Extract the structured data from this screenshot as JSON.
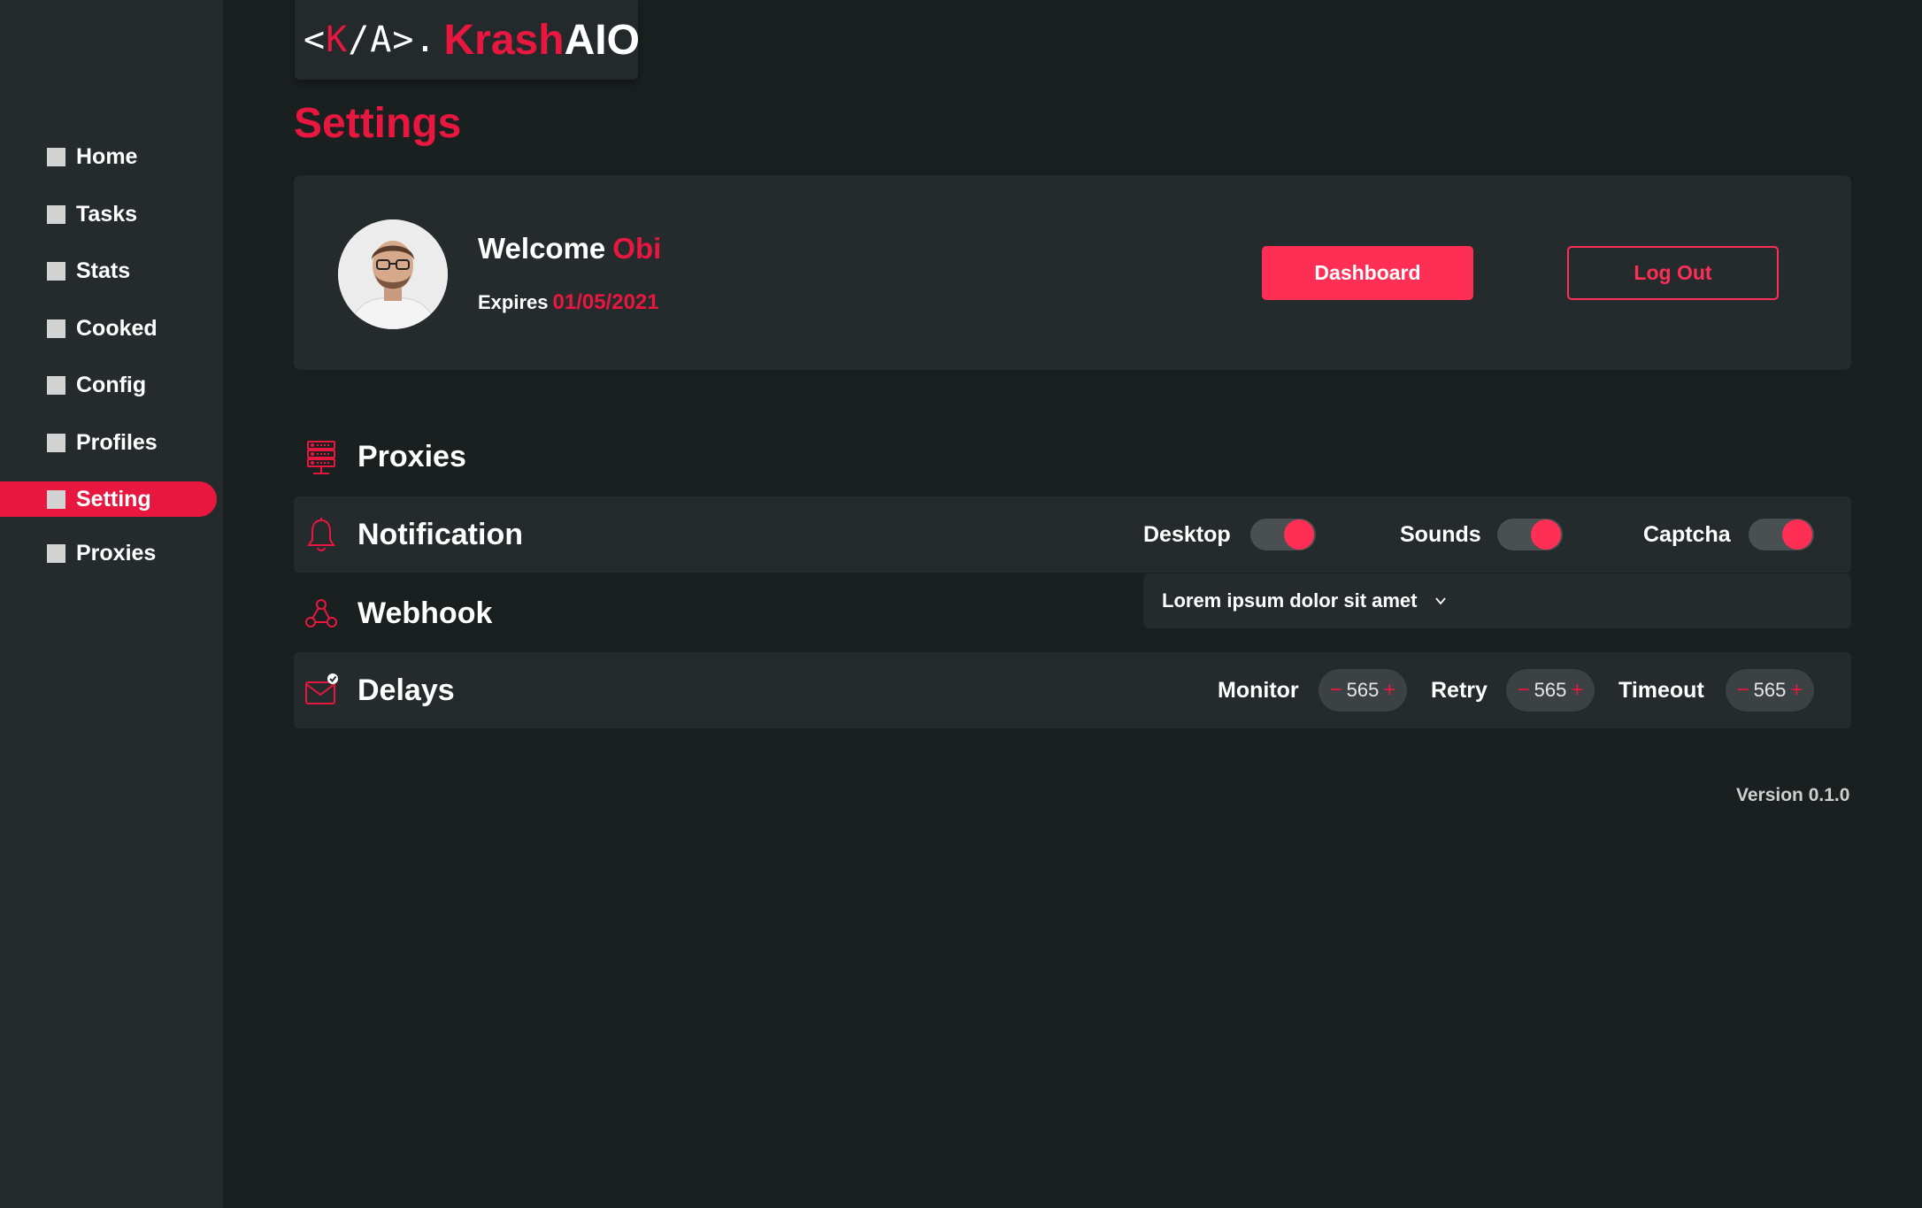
{
  "logo": {
    "mark_left": "<",
    "mark_k": "K",
    "mark_rest": "/A>.",
    "name_red": "Krash",
    "name_white": "AIO"
  },
  "page_title": "Settings",
  "sidebar": {
    "items": [
      {
        "label": "Home",
        "active": false
      },
      {
        "label": "Tasks",
        "active": false
      },
      {
        "label": "Stats",
        "active": false
      },
      {
        "label": "Cooked",
        "active": false
      },
      {
        "label": "Config",
        "active": false
      },
      {
        "label": "Profiles",
        "active": false
      },
      {
        "label": "Setting",
        "active": true
      },
      {
        "label": "Proxies",
        "active": false
      }
    ]
  },
  "profile": {
    "welcome_label": "Welcome",
    "username": "Obi",
    "expires_label": "Expires",
    "expires_date": "01/05/2021",
    "dashboard_button": "Dashboard",
    "logout_button": "Log Out"
  },
  "sections": {
    "proxies": {
      "title": "Proxies",
      "icon": "server-icon"
    },
    "notification": {
      "title": "Notification",
      "icon": "bell-icon",
      "toggles": [
        {
          "label": "Desktop",
          "on": true
        },
        {
          "label": "Sounds",
          "on": true
        },
        {
          "label": "Captcha",
          "on": true
        }
      ]
    },
    "webhook": {
      "title": "Webhook",
      "icon": "webhook-icon",
      "selected": "Lorem ipsum dolor sit amet"
    },
    "delays": {
      "title": "Delays",
      "icon": "mail-check-icon",
      "steppers": [
        {
          "label": "Monitor",
          "value": "565",
          "minus": "−",
          "plus": "+"
        },
        {
          "label": "Retry",
          "value": "565",
          "minus": "−",
          "plus": "+"
        },
        {
          "label": "Timeout",
          "value": "565",
          "minus": "−",
          "plus": "+"
        }
      ]
    }
  },
  "version": "Version 0.1.0",
  "colors": {
    "accent": "#e8173f",
    "button": "#ff2e55",
    "sidebar": "#252b2c",
    "background": "#1a1f20"
  }
}
